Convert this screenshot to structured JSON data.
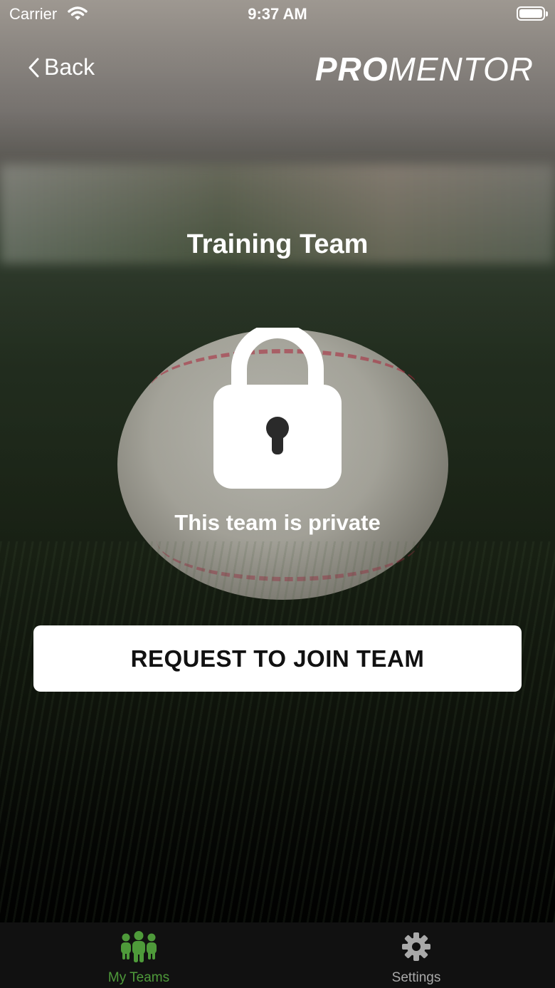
{
  "status_bar": {
    "carrier": "Carrier",
    "time": "9:37 AM"
  },
  "nav": {
    "back_label": "Back",
    "logo_bold": "PRO",
    "logo_light": "MENTOR"
  },
  "team": {
    "name": "Training Team",
    "privacy_message": "This team is private"
  },
  "actions": {
    "join_button": "REQUEST TO JOIN TEAM"
  },
  "tabbar": {
    "tabs": [
      {
        "label": "My Teams",
        "icon": "team-icon",
        "active": true
      },
      {
        "label": "Settings",
        "icon": "gear-icon",
        "active": false
      }
    ]
  },
  "background": {
    "image_subject": "baseball-on-grass"
  },
  "colors": {
    "active_tab": "#4e9a3a",
    "inactive_tab": "#a9a9a9",
    "button_bg": "#ffffff"
  }
}
